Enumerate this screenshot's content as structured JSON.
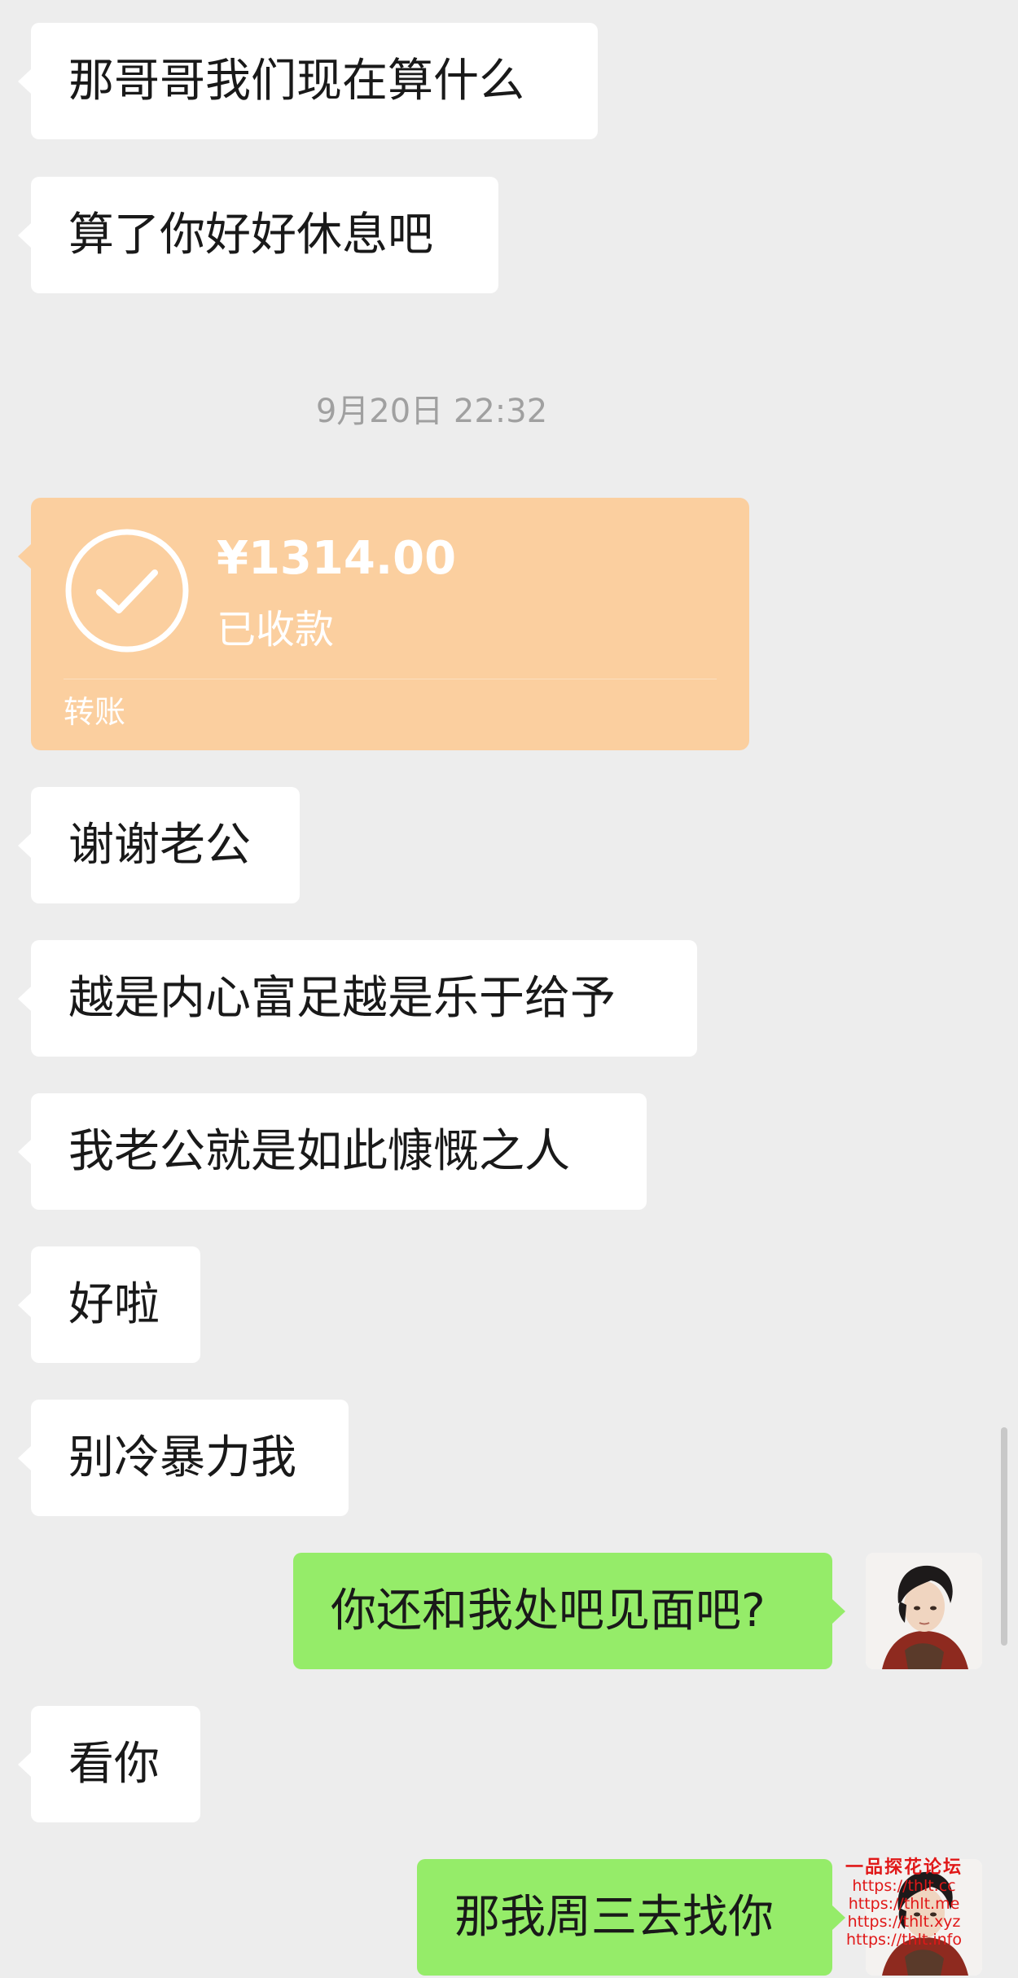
{
  "messages": [
    {
      "text": "那哥哥我们现在算什么"
    },
    {
      "text": "算了你好好休息吧"
    },
    {
      "text": "谢谢老公"
    },
    {
      "text": "越是内心富足越是乐于给予"
    },
    {
      "text": "我老公就是如此慷慨之人"
    },
    {
      "text": "好啦"
    },
    {
      "text": "别冷暴力我"
    },
    {
      "text": "你还和我处吧见面吧?"
    },
    {
      "text": "看你"
    },
    {
      "text": "那我周三去找你"
    }
  ],
  "timestamp": "9月20日 22:32",
  "transfer": {
    "amount": "¥1314.00",
    "status": "已收款",
    "label": "转账",
    "color": "#fbcf9f"
  },
  "watermark": {
    "title": "一品探花论坛",
    "lines": [
      "https://thlt.cc",
      "https://thlt.me",
      "https://thlt.xyz",
      "https://thlt.info"
    ]
  },
  "colors": {
    "background": "#ededed",
    "incoming_bubble": "#ffffff",
    "outgoing_bubble": "#95ec69"
  }
}
